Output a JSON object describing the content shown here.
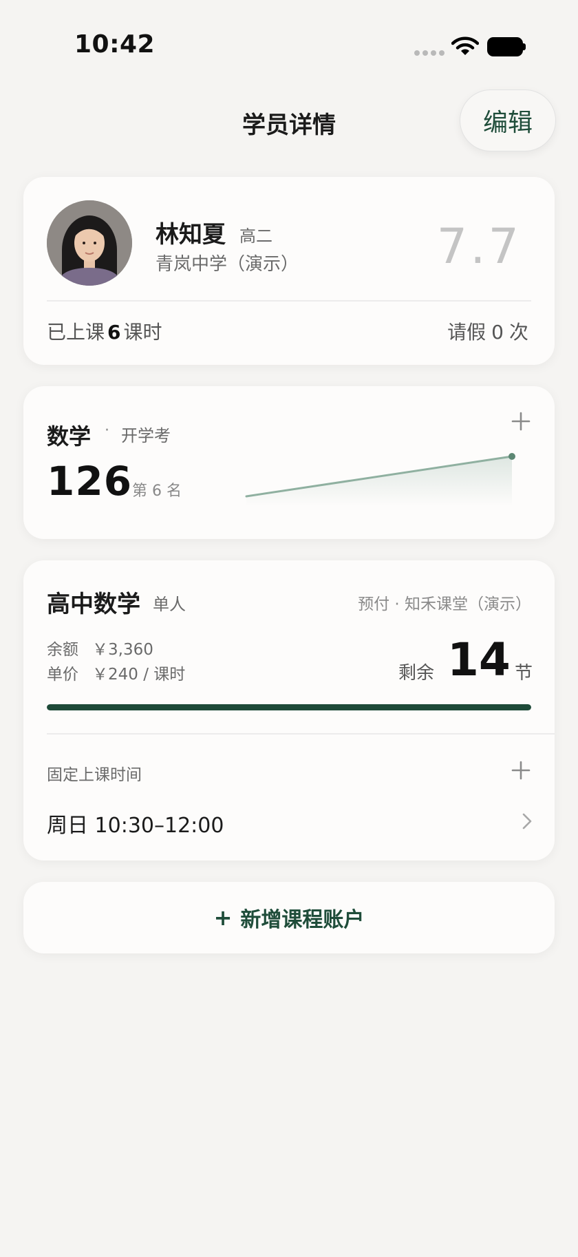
{
  "status_bar": {
    "time": "10:42"
  },
  "nav": {
    "title": "学员详情",
    "edit_label": "编辑"
  },
  "profile": {
    "name": "林知夏",
    "grade": "高二",
    "school": "青岚中学（演示）",
    "score": "7.7",
    "attended_prefix": "已上课",
    "attended_count": "6",
    "attended_unit": "课时",
    "leave_prefix": "请假",
    "leave_count": "0",
    "leave_unit": "次"
  },
  "exam": {
    "subject": "数学",
    "separator": "·",
    "exam_name": "开学考",
    "score": "126",
    "rank": "第 6 名"
  },
  "course": {
    "title": "高中数学",
    "type": "单人",
    "meta": "预付 · 知禾课堂（演示）",
    "balance_label": "余额",
    "balance_value": "￥3,360",
    "price_label": "单价",
    "price_value": "￥240 / 课时",
    "remain_label": "剩余",
    "remain_count": "14",
    "remain_unit": "节",
    "progress": 1.0,
    "schedule_label": "固定上课时间",
    "schedule_time": "周日 10:30–12:00"
  },
  "add_course": {
    "label": "新增课程账户"
  },
  "colors": {
    "accent": "#1e4a38",
    "background": "#f5f4f2",
    "card": "#fdfcfb"
  }
}
